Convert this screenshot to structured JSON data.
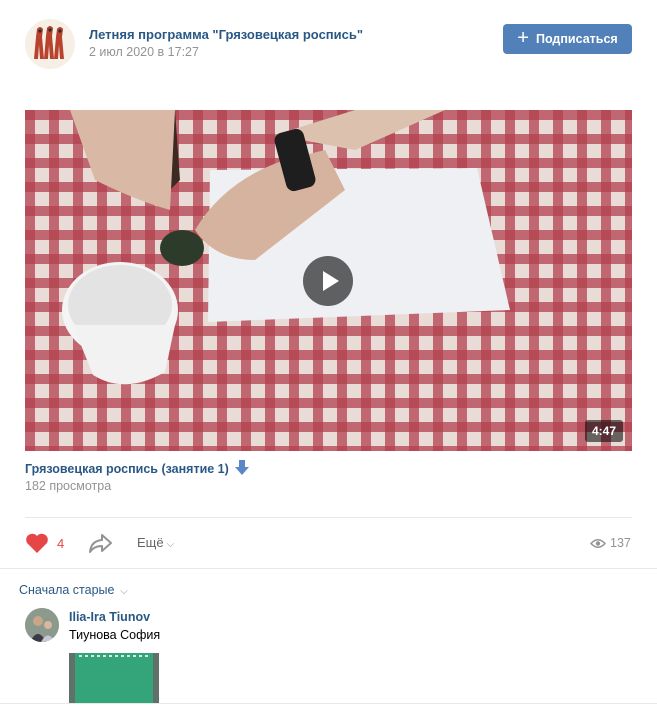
{
  "post": {
    "group_name": "Летняя программа \"Грязовецкая роспись\"",
    "date": "2 июл 2020 в 17:27",
    "subscribe_label": "Подписаться"
  },
  "video": {
    "duration": "4:47",
    "title": "Грязовецкая роспись (занятие 1)",
    "views": "182 просмотра"
  },
  "actions": {
    "likes": "4",
    "more_label": "Ещё",
    "views_count": "137"
  },
  "comments": {
    "sort_label": "Сначала старые",
    "items": [
      {
        "author": "Ilia-Ira Tiunov",
        "text": "Тиунова София"
      }
    ]
  },
  "colors": {
    "link": "#2a5885",
    "button": "#5181b8",
    "like": "#e64646",
    "muted": "#939393"
  }
}
